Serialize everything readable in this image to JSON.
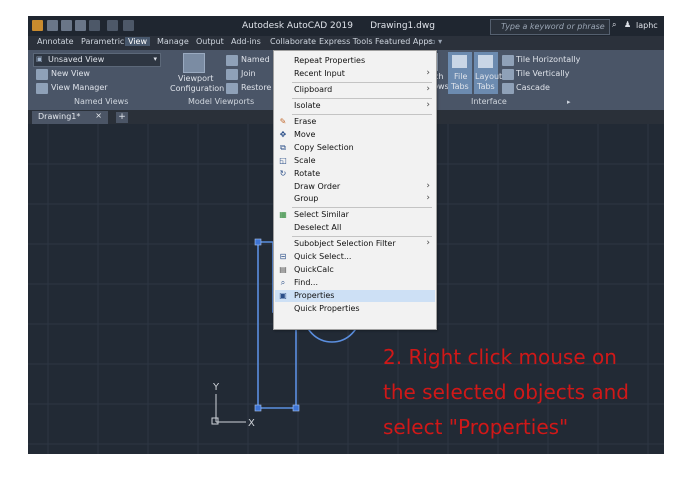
{
  "titlebar": {
    "app_title": "Autodesk AutoCAD 2019",
    "doc_title": "Drawing1.dwg",
    "search_placeholder": "Type a keyword or phrase",
    "user": "laphc"
  },
  "ribbon_tabs": [
    "Annotate",
    "Parametric",
    "View",
    "Manage",
    "Output",
    "Add-ins",
    "Collaborate",
    "Express Tools",
    "Featured Apps"
  ],
  "active_tab": "View",
  "ribbon": {
    "named_views": {
      "dropdown": "Unsaved View",
      "new_view": "New View",
      "view_manager": "View Manager",
      "label": "Named Views"
    },
    "model_viewports": {
      "viewport_config_line1": "Viewport",
      "viewport_config_line2": "Configuration",
      "named": "Named",
      "join": "Join",
      "restore": "Restore",
      "label": "Model Viewports"
    },
    "interface": {
      "switch_line1": "Switch",
      "switch_line2": "Windows",
      "file_line1": "File",
      "file_line2": "Tabs",
      "layout_line1": "Layout",
      "layout_line2": "Tabs",
      "tile_h": "Tile Horizontally",
      "tile_v": "Tile Vertically",
      "cascade": "Cascade",
      "label": "Interface"
    }
  },
  "doc_tab": "Drawing1*",
  "context_menu": {
    "items": [
      {
        "label": "Repeat Properties",
        "icon": "",
        "submenu": false
      },
      {
        "label": "Recent Input",
        "icon": "",
        "submenu": true
      },
      {
        "label": "Clipboard",
        "icon": "",
        "submenu": true
      },
      {
        "label": "Isolate",
        "icon": "",
        "submenu": true
      },
      {
        "label": "Erase",
        "icon": "eraser-icon",
        "submenu": false
      },
      {
        "label": "Move",
        "icon": "move-icon",
        "submenu": false
      },
      {
        "label": "Copy Selection",
        "icon": "copy-icon",
        "submenu": false
      },
      {
        "label": "Scale",
        "icon": "scale-icon",
        "submenu": false
      },
      {
        "label": "Rotate",
        "icon": "rotate-icon",
        "submenu": false
      },
      {
        "label": "Draw Order",
        "icon": "",
        "submenu": true
      },
      {
        "label": "Group",
        "icon": "",
        "submenu": true
      },
      {
        "label": "Select Similar",
        "icon": "select-similar-icon",
        "submenu": false
      },
      {
        "label": "Deselect All",
        "icon": "",
        "submenu": false
      },
      {
        "label": "Subobject Selection Filter",
        "icon": "",
        "submenu": true
      },
      {
        "label": "Quick Select...",
        "icon": "quick-select-icon",
        "submenu": false
      },
      {
        "label": "QuickCalc",
        "icon": "calculator-icon",
        "submenu": false
      },
      {
        "label": "Find...",
        "icon": "find-icon",
        "submenu": false
      },
      {
        "label": "Properties",
        "icon": "properties-icon",
        "submenu": false,
        "highlighted": true
      },
      {
        "label": "Quick Properties",
        "icon": "",
        "submenu": false
      }
    ]
  },
  "ucs": {
    "y_label": "Y",
    "x_label": "X"
  },
  "instruction_lines": [
    "2. Right click mouse on",
    "the selected objects and",
    "select \"Properties\""
  ]
}
